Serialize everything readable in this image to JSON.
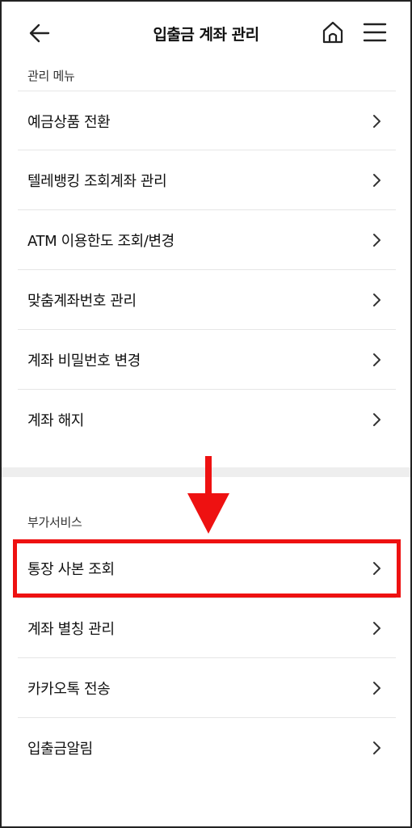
{
  "header": {
    "title": "입출금 계좌 관리",
    "back_icon": "back-arrow-icon",
    "home_icon": "home-icon",
    "menu_icon": "hamburger-menu-icon"
  },
  "sections": [
    {
      "label": "관리 메뉴",
      "items": [
        {
          "label": "예금상품 전환"
        },
        {
          "label": "텔레뱅킹 조회계좌 관리"
        },
        {
          "label": "ATM 이용한도 조회/변경"
        },
        {
          "label": "맞춤계좌번호 관리"
        },
        {
          "label": "계좌 비밀번호 변경"
        },
        {
          "label": "계좌 해지"
        }
      ]
    },
    {
      "label": "부가서비스",
      "items": [
        {
          "label": "통장 사본 조회"
        },
        {
          "label": "계좌 별칭 관리"
        },
        {
          "label": "카카오톡 전송"
        },
        {
          "label": "입출금알림"
        }
      ]
    }
  ],
  "annotation": {
    "highlight_color": "#ee1111",
    "arrow_color": "#ee1111",
    "highlighted_item": "통장 사본 조회"
  }
}
